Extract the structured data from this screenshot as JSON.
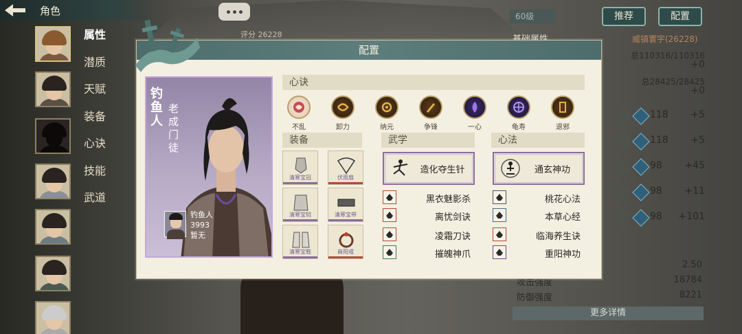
{
  "nav": {
    "title": "角色",
    "menu": [
      "属性",
      "潜质",
      "天赋",
      "装备",
      "心诀",
      "技能",
      "武道"
    ],
    "active_menu_index": 0
  },
  "top_right": {
    "level": "60级",
    "recommend_label": "推荐",
    "config_label": "配置",
    "score": "评分 26228",
    "base_attr_label": "基础属性",
    "character_name_power": "威镇寰宇(26228)"
  },
  "right_stats": {
    "hp": "总110316/110316",
    "hp_plus": "+0",
    "mp": "总28425/28425",
    "mp_plus": "+0",
    "rows": [
      {
        "value": "118",
        "plus": "+5"
      },
      {
        "value": "118",
        "plus": "+5"
      },
      {
        "value": "98",
        "plus": "+45"
      },
      {
        "value": "98",
        "plus": "+11"
      },
      {
        "value": "98",
        "plus": "+101"
      }
    ]
  },
  "bottom_stats": {
    "rows": [
      {
        "key": "",
        "value": "2.50"
      },
      {
        "key": "攻击强度",
        "value": "18784"
      },
      {
        "key": "防御强度",
        "value": "8221"
      }
    ],
    "more_label": "更多详情"
  },
  "modal": {
    "title": "配置",
    "character": {
      "name_vertical": "钓鱼人",
      "title_vertical": "老成门徒",
      "info_name": "钓鱼人",
      "info_score": "3993",
      "info_status": "暂无"
    },
    "xinjue": {
      "header": "心诀",
      "items": [
        {
          "label": "不乱",
          "color": "#c84a55"
        },
        {
          "label": "卸力",
          "color": "#c9962e"
        },
        {
          "label": "纳元",
          "color": "#c9962e"
        },
        {
          "label": "争锋",
          "color": "#c9962e"
        },
        {
          "label": "一心",
          "color": "#5a3c9a"
        },
        {
          "label": "龟寿",
          "color": "#5a3c9a"
        },
        {
          "label": "退邪",
          "color": "#c9962e"
        }
      ]
    },
    "equipment": {
      "header": "装备",
      "items": [
        {
          "label": "清寒宝冠"
        },
        {
          "label": "伏雨扇"
        },
        {
          "label": "清寒宝铠"
        },
        {
          "label": "清寒宝带"
        },
        {
          "label": "清寒宝鞋"
        },
        {
          "label": "商阳戒"
        }
      ]
    },
    "wuxue": {
      "header": "武学",
      "main": "造化夺生针",
      "list": [
        "黑衣魅影杀",
        "离忧剑诀",
        "凌霜刀诀",
        "摧魄神爪"
      ]
    },
    "xinfa": {
      "header": "心法",
      "main": "通玄神功",
      "list": [
        "桃花心法",
        "本草心经",
        "临海养生诀",
        "重阳神功"
      ]
    }
  },
  "colors": {
    "header_bg": "#4d6c6c",
    "card_border": "#c7a7d9",
    "rarity_purple": "#8b6d9a",
    "rarity_red": "#b44a3a"
  }
}
